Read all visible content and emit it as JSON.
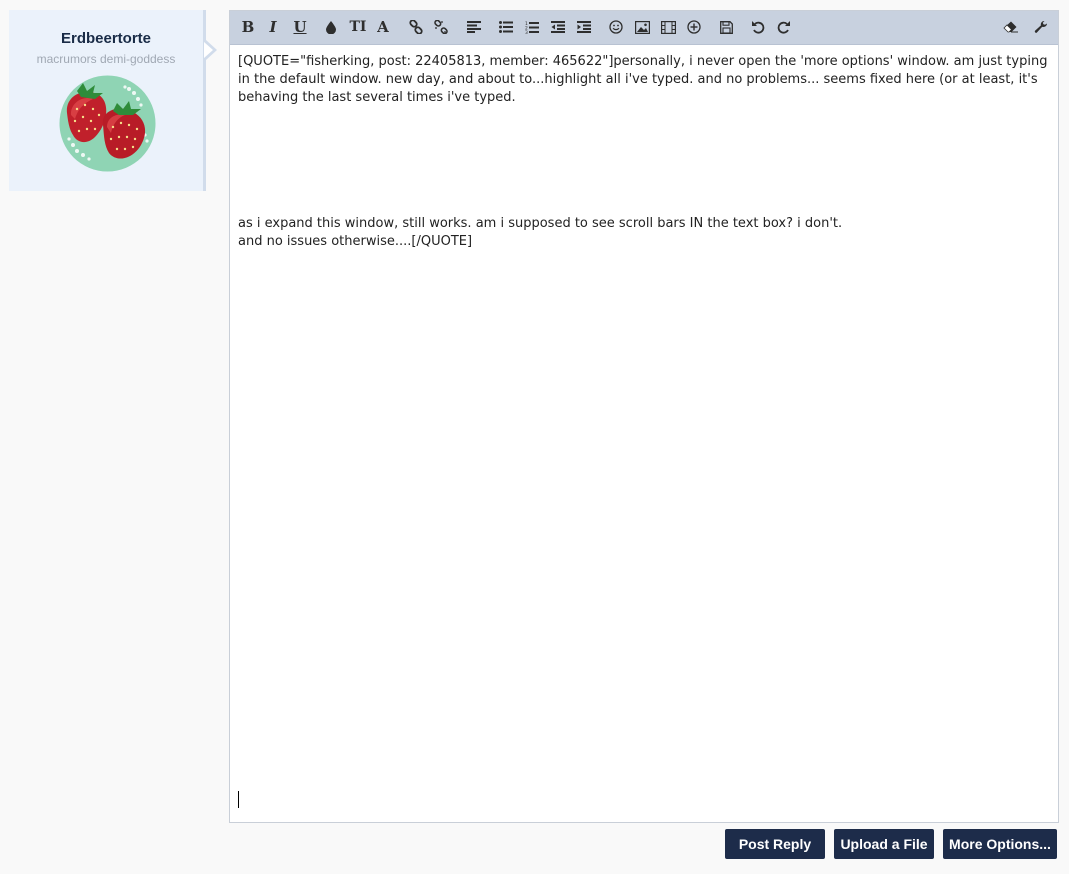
{
  "user": {
    "name": "Erdbeertorte",
    "title": "macrumors demi-goddess"
  },
  "editor": {
    "toolbar": {
      "bold": "B",
      "italic": "I",
      "underline": "U",
      "font_size": "TI",
      "font_family": "A"
    },
    "content": {
      "paragraph1": "[QUOTE=\"fisherking, post: 22405813, member: 465622\"]personally, i never open the 'more options' window. am just typing in the default window. new day, and about to...highlight all i've typed. and no problems... seems fixed here (or at least, it's behaving the last several times i've typed.",
      "paragraph2_line1": "as i expand this window, still works. am i supposed to see scroll bars IN the text box? i don't.",
      "paragraph2_line2": "and no issues otherwise....[/QUOTE]"
    }
  },
  "actions": {
    "post_reply": "Post Reply",
    "upload_file": "Upload a File",
    "more_options": "More Options..."
  },
  "colors": {
    "toolbar_bg": "#c8d1df",
    "button_bg": "#1d2c4a",
    "usercard_bg": "#ebf2fb",
    "username_color": "#1a2c47"
  },
  "icons": [
    "bold-icon",
    "italic-icon",
    "underline-icon",
    "text-color-icon",
    "font-size-icon",
    "font-family-icon",
    "link-icon",
    "unlink-icon",
    "align-icon",
    "bullet-list-icon",
    "numbered-list-icon",
    "outdent-icon",
    "indent-icon",
    "smilie-icon",
    "image-icon",
    "media-icon",
    "insert-icon",
    "save-draft-icon",
    "undo-icon",
    "redo-icon",
    "remove-format-icon",
    "settings-wrench-icon"
  ]
}
